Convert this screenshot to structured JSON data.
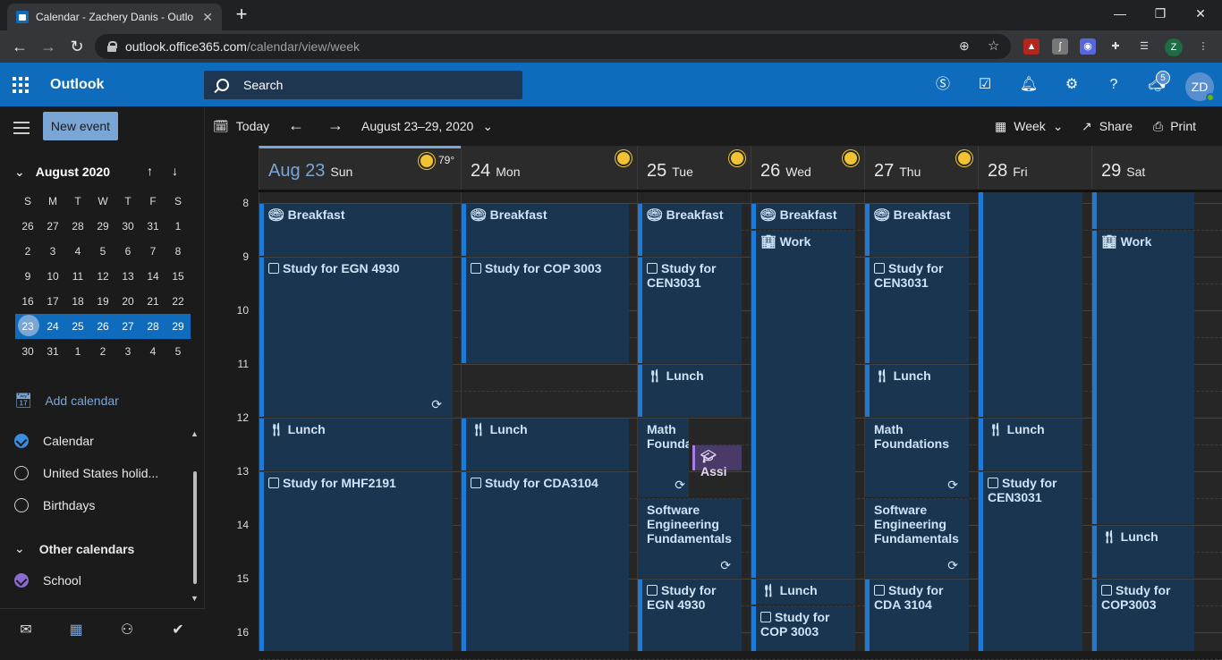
{
  "browser": {
    "tab_title": "Calendar - Zachery Danis - Outlo",
    "url_host": "outlook.office365.com",
    "url_path": "/calendar/view/week"
  },
  "app": {
    "name": "Outlook",
    "search_placeholder": "Search",
    "notifications_count": "5",
    "avatar_initials": "ZD"
  },
  "toolbar": {
    "new_event": "New event",
    "today": "Today",
    "date_range": "August 23–29, 2020",
    "view": "Week",
    "share": "Share",
    "print": "Print"
  },
  "mini_calendar": {
    "month": "August 2020",
    "weekdays": [
      "S",
      "M",
      "T",
      "W",
      "T",
      "F",
      "S"
    ],
    "weeks": [
      [
        "26",
        "27",
        "28",
        "29",
        "30",
        "31",
        "1"
      ],
      [
        "2",
        "3",
        "4",
        "5",
        "6",
        "7",
        "8"
      ],
      [
        "9",
        "10",
        "11",
        "12",
        "13",
        "14",
        "15"
      ],
      [
        "16",
        "17",
        "18",
        "19",
        "20",
        "21",
        "22"
      ],
      [
        "23",
        "24",
        "25",
        "26",
        "27",
        "28",
        "29"
      ],
      [
        "30",
        "31",
        "1",
        "2",
        "3",
        "4",
        "5"
      ]
    ]
  },
  "calendars": {
    "add_label": "Add calendar",
    "items": [
      "Calendar",
      "United States holid...",
      "Birthdays"
    ],
    "other_header": "Other calendars",
    "other_items": [
      "School"
    ]
  },
  "days": [
    {
      "num": "Aug 23",
      "name": "Sun",
      "temp": "79°"
    },
    {
      "num": "24",
      "name": "Mon"
    },
    {
      "num": "25",
      "name": "Tue"
    },
    {
      "num": "26",
      "name": "Wed"
    },
    {
      "num": "27",
      "name": "Thu"
    },
    {
      "num": "28",
      "name": "Fri"
    },
    {
      "num": "29",
      "name": "Sat"
    }
  ],
  "hours": [
    "8",
    "9",
    "10",
    "11",
    "12",
    "13",
    "14",
    "15",
    "16"
  ],
  "events": {
    "sun": [
      "Breakfast",
      "Study for EGN 4930",
      "Lunch",
      "Study for MHF2191"
    ],
    "mon": [
      "Breakfast",
      "Study for COP 3003",
      "Lunch",
      "Study for CDA3104"
    ],
    "tue": [
      "Breakfast",
      "Study for CEN3031",
      "Lunch",
      "Math Founda",
      "Assi",
      "Software Engineering Fundamentals",
      "Study for EGN 4930"
    ],
    "wed": [
      "Breakfast",
      "Work",
      "Lunch",
      "Study for COP 3003"
    ],
    "thu": [
      "Breakfast",
      "Study for CEN3031",
      "Lunch",
      "Math Foundations",
      "Software Engineering Fundamentals",
      "Study for CDA 3104"
    ],
    "fri": [
      "Lunch",
      "Study for CEN3031"
    ],
    "sat": [
      "Work",
      "Lunch",
      "Study for COP3003"
    ]
  },
  "colors": {
    "accent": "#0f6cbd",
    "event_bg": "#1a3550",
    "event_border": "#1f7ad6",
    "school": "#8c6bd1"
  }
}
